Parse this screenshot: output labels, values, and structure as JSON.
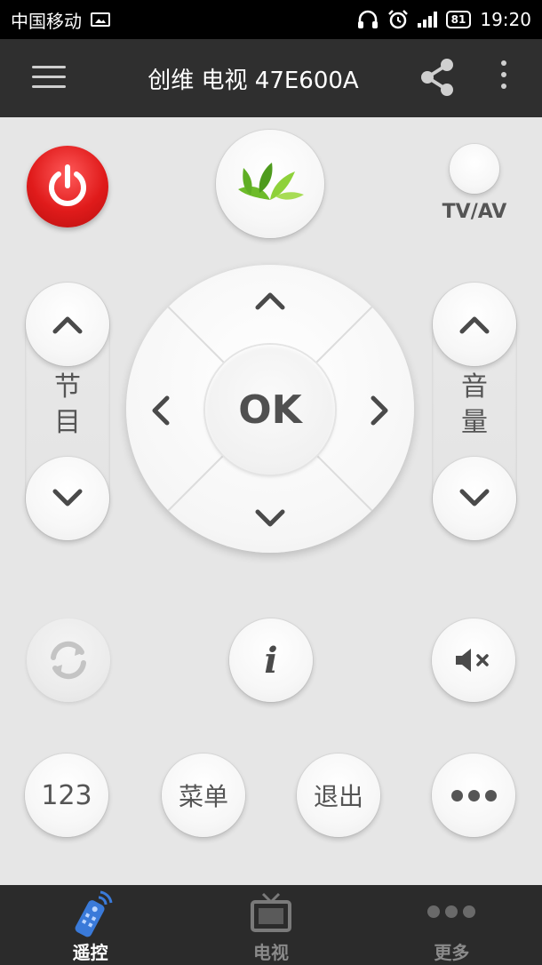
{
  "status_bar": {
    "carrier": "中国移动",
    "battery": "81",
    "time": "19:20"
  },
  "app_bar": {
    "title": "创维 电视 47E600A"
  },
  "remote": {
    "tvav_label": "TV/AV",
    "channel_label": "节目",
    "volume_label": "音量",
    "ok_label": "OK",
    "info_label": "i",
    "numbers_label": "123",
    "menu_label": "菜单",
    "exit_label": "退出"
  },
  "tabs": [
    {
      "label": "遥控",
      "icon": "remote-icon",
      "active": true
    },
    {
      "label": "电视",
      "icon": "tv-icon",
      "active": false
    },
    {
      "label": "更多",
      "icon": "more-icon",
      "active": false
    }
  ],
  "colors": {
    "power": "#e01b1b",
    "background": "#e6e6e6",
    "app_bar": "#2f2f2f",
    "tab_bar": "#2b2b2b",
    "remote_tab_icon": "#3a7ad9"
  }
}
